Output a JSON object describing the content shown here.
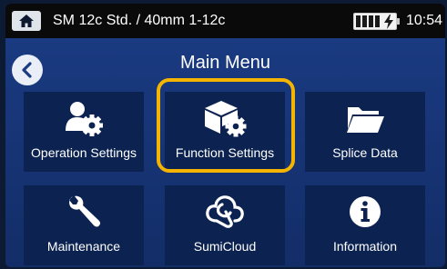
{
  "statusbar": {
    "home_icon": "home-icon",
    "title": "SM 12c Std. / 40mm 1-12c",
    "battery_icon": "battery-charging-icon",
    "time": "10:54"
  },
  "header": {
    "back_icon": "back-arrow-icon",
    "title": "Main Menu"
  },
  "menu": {
    "items": [
      {
        "label": "Operation Settings",
        "icon": "user-gear-icon"
      },
      {
        "label": "Function Settings",
        "icon": "cube-gear-icon",
        "selected": true
      },
      {
        "label": "Splice Data",
        "icon": "folder-icon"
      },
      {
        "label": "Maintenance",
        "icon": "wrench-icon"
      },
      {
        "label": "SumiCloud",
        "icon": "cloud-icon"
      },
      {
        "label": "Information",
        "icon": "info-icon"
      }
    ]
  },
  "colors": {
    "background": "#163373",
    "tile": "#0c2250",
    "highlight": "#f4b400",
    "statusbar": "#0a0a0a"
  }
}
